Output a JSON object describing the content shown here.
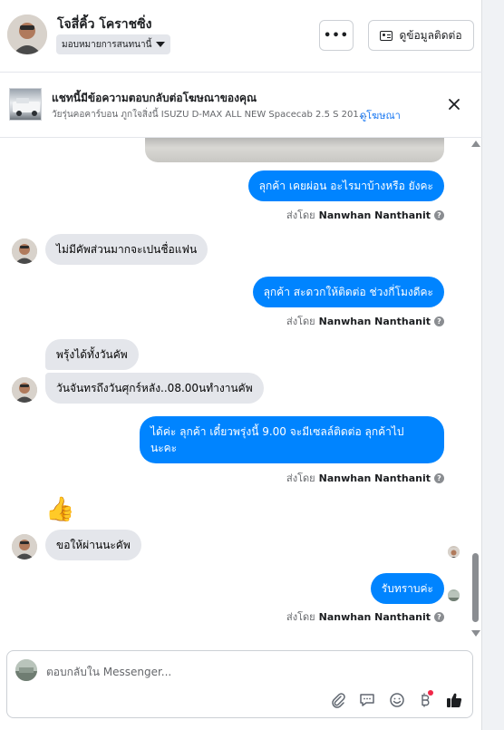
{
  "header": {
    "contact_name": "โจสี่คิ้ว โคราชซิ่ง",
    "assign_label": "มอบหมายการสนทนานี้",
    "more_label": "•••",
    "info_button_label": "ดูข้อมูลติดต่อ"
  },
  "ad_banner": {
    "title": "แชทนี้มีข้อความตอบกลับต่อโฆษณาของคุณ",
    "subtitle": "วัยรุ่นคอคาร์บอน ภูกใจสิ่งนี้ ISUZU D-MAX ALL NEW Spacecab 2.5 S 201...",
    "link_label": "ดูโฆษณา"
  },
  "messages": [
    {
      "direction": "out",
      "text": "ลุกค้า เคยผ่อน อะไรมาบ้างหรือ ยังคะ"
    },
    {
      "direction": "in",
      "text": "ไม่มีคัพส่วนมากจะเปนชื่อแฟน"
    },
    {
      "direction": "out",
      "text": "ลุกค้า สะดวกให้ติดต่อ ช่วงกี่โมงดีคะ"
    },
    {
      "direction": "in",
      "text": "พรุ้งได้ทั้งวันคัพ"
    },
    {
      "direction": "in",
      "text": "วันจันทรถึงวันศุกร์หลัง..08.00นทำงานคัพ"
    },
    {
      "direction": "out",
      "text": "ได้ค่ะ ลุกค้า เดี๋ยวพรุ่งนี้ 9.00 จะมีเซลล์ติดต่อ ลุกค้าไป นะคะ"
    },
    {
      "direction": "in",
      "text": "👍"
    },
    {
      "direction": "in",
      "text": "ขอให้ผ่านนะคัพ"
    },
    {
      "direction": "out",
      "text": "รับทราบค่ะ"
    }
  ],
  "sent_by": {
    "prefix": "ส่งโดย",
    "name": "Nanwhan Nanthanit",
    "help_symbol": "?"
  },
  "composer": {
    "placeholder": "ตอบกลับใน Messenger..."
  },
  "icons": [
    "ellipsis-icon",
    "contact-card-icon",
    "close-icon",
    "question-icon",
    "thumbs-up-icon",
    "paperclip-icon",
    "saved-reply-icon",
    "emoji-icon",
    "payment-icon",
    "like-icon"
  ],
  "colors": {
    "outgoing_bubble": "#0084ff",
    "incoming_bubble": "#e4e6eb",
    "link": "#1877f2",
    "notification_dot": "#f02849"
  }
}
